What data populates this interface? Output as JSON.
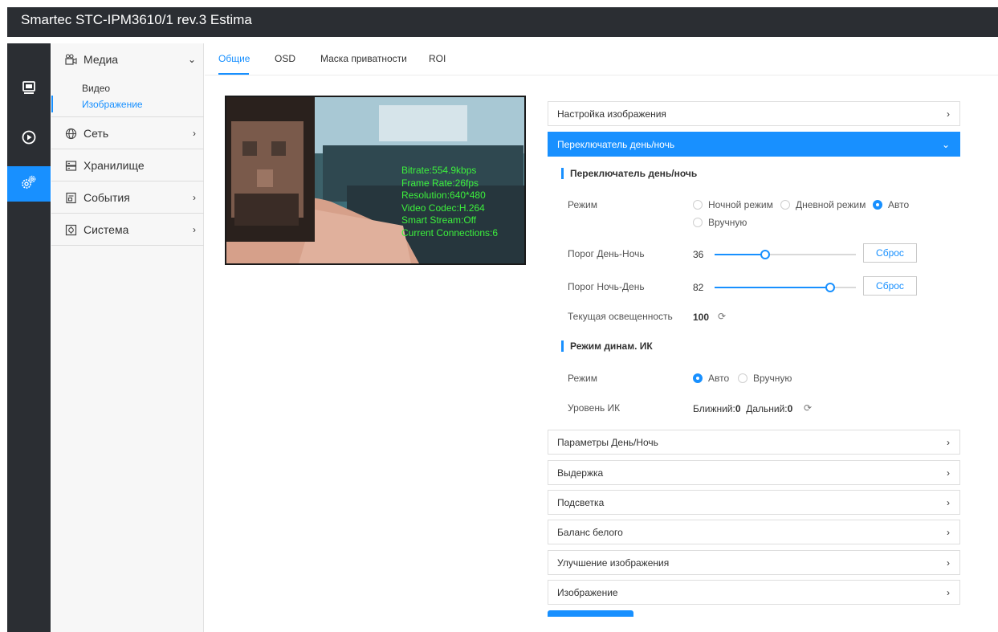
{
  "app": {
    "title": "Smartec STC-IPM3610/1 rev.3 Estima"
  },
  "rail": {
    "items": [
      {
        "icon": "live-view-icon",
        "active": false
      },
      {
        "icon": "playback-icon",
        "active": false
      },
      {
        "icon": "settings-icon",
        "active": true
      }
    ]
  },
  "sidebar": {
    "media": {
      "label": "Медиа",
      "sub": [
        "Видео",
        "Изображение"
      ]
    },
    "network": {
      "label": "Сеть"
    },
    "storage": {
      "label": "Хранилище"
    },
    "events": {
      "label": "События"
    },
    "system": {
      "label": "Система"
    }
  },
  "tabs": [
    "Общие",
    "OSD",
    "Маска приватности",
    "ROI"
  ],
  "video": {
    "osd": [
      "Bitrate:554.9kbps",
      "Frame Rate:26fps",
      "Resolution:640*480",
      "Video Codec:H.264",
      "Smart Stream:Off",
      "Current Connections:6"
    ]
  },
  "panel": {
    "image_settings": "Настройка изображения",
    "daynight_switch": "Переключатель день/ночь",
    "section_daynight": "Переключатель день/ночь",
    "mode_label": "Режим",
    "modes": [
      "Ночной режим",
      "Дневной режим",
      "Авто",
      "Вручную"
    ],
    "daynight_threshold_label": "Порог День-Ночь",
    "daynight_threshold_value": "36",
    "daynight_threshold_level": 0.36,
    "nightday_threshold_label": "Порог Ночь-День",
    "nightday_threshold_value": "82",
    "nightday_threshold_level": 0.82,
    "reset_label": "Сброс",
    "illuminance_label": "Текущая освещенность",
    "illuminance_value": "100",
    "section_ir": "Режим динам. ИК",
    "ir_mode_label": "Режим",
    "ir_modes": [
      "Авто",
      "Вручную"
    ],
    "ir_level_label": "Уровень ИК",
    "ir_near_label": "Ближний:",
    "ir_near_value": "0",
    "ir_far_label": "Дальний:",
    "ir_far_value": "0",
    "collapsed": [
      "Параметры День/Ночь",
      "Выдержка",
      "Подсветка",
      "Баланс белого",
      "Улучшение изображения",
      "Изображение"
    ]
  },
  "colors": {
    "accent": "#1890ff",
    "topbar": "#2b2e33",
    "osd_text": "#3cf03c"
  }
}
